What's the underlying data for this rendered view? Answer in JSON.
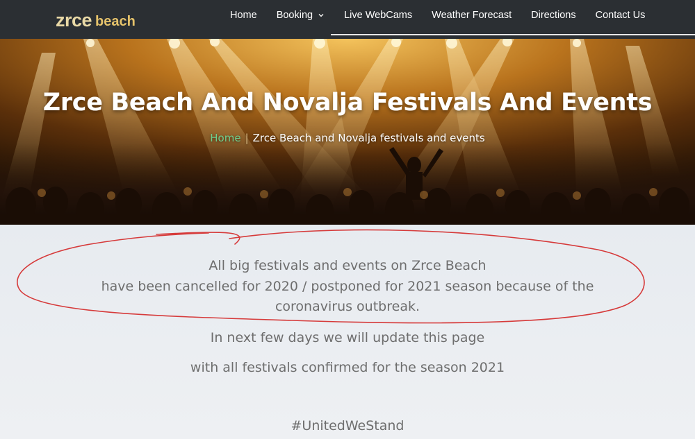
{
  "nav": {
    "logo_main": "zrce",
    "logo_sub": "beach",
    "items": [
      {
        "label": "Home"
      },
      {
        "label": "Booking"
      },
      {
        "label": "Live WebCams"
      },
      {
        "label": "Weather Forecast"
      },
      {
        "label": "Directions"
      },
      {
        "label": "Contact Us"
      }
    ]
  },
  "hero": {
    "title": "Zrce Beach And Novalja Festivals And Events",
    "breadcrumb": {
      "home": "Home",
      "separator": "|",
      "current": "Zrce Beach and Novalja festivals and events"
    }
  },
  "content": {
    "notice_line1": "All big festivals and events on Zrce Beach",
    "notice_line2": "have been cancelled for 2020 / postponed for 2021 season because of the",
    "notice_line3": "coronavirus outbreak.",
    "update_line1": "In next few days we will update this page",
    "update_line2": "with all festivals confirmed for the season 2021",
    "hashtag": "#UnitedWeStand"
  },
  "colors": {
    "nav_bg": "#2b2f33",
    "breadcrumb_home": "#6fcf8e",
    "annotation_red": "#d63a3a",
    "body_text": "#6e6e6e"
  },
  "icons": [
    "chevron-down-icon"
  ]
}
